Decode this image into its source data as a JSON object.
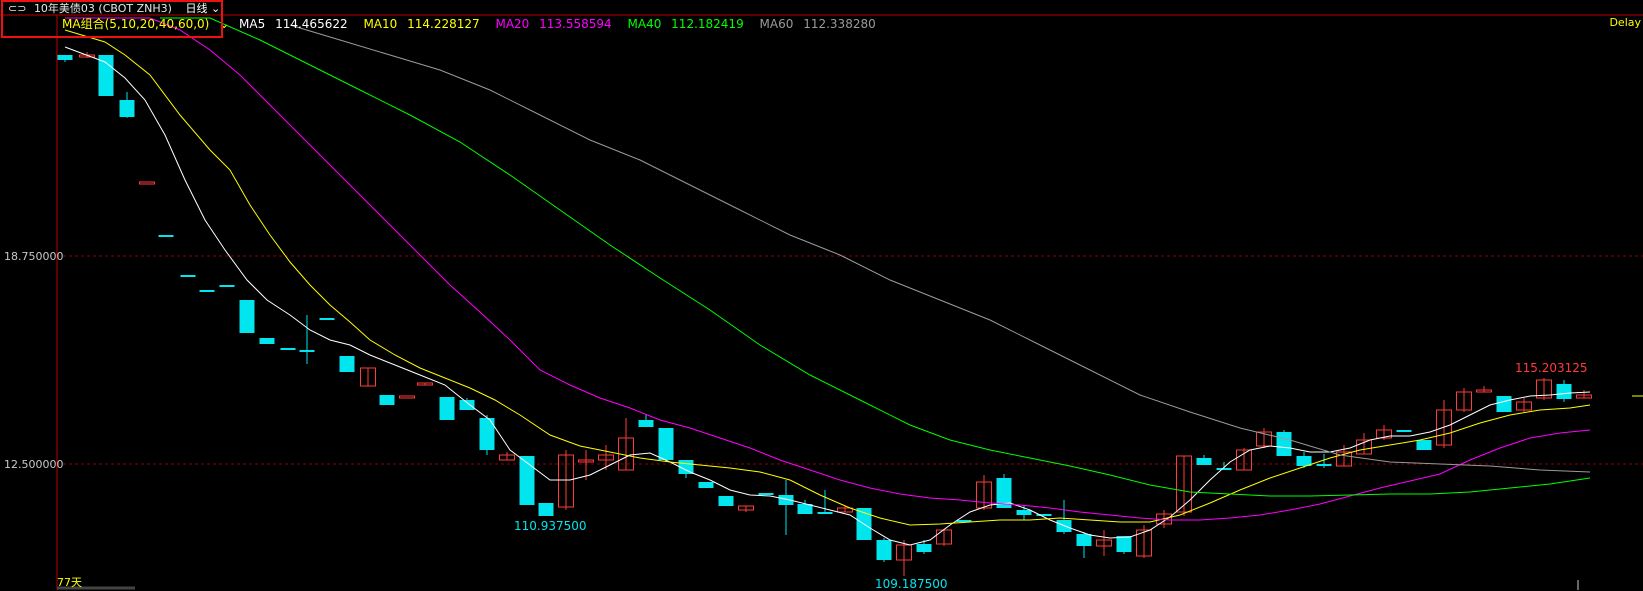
{
  "header": {
    "symbol": "10年美债03 (CBOT ZNH3)",
    "period": "日线",
    "ma_group": "MA组合(5,10,20,40,60,0)",
    "ma": [
      {
        "label": "MA5",
        "value": "114.465622",
        "color": "#ffffff"
      },
      {
        "label": "MA10",
        "value": "114.228127",
        "color": "#ffff00"
      },
      {
        "label": "MA20",
        "value": "113.558594",
        "color": "#ff00ff"
      },
      {
        "label": "MA40",
        "value": "112.182419",
        "color": "#00ff00"
      },
      {
        "label": "MA60",
        "value": "112.338280",
        "color": "#9a9a9a"
      }
    ],
    "delay": "Delay"
  },
  "axis": {
    "y_upper": "18.750000",
    "y_lower": "12.500000"
  },
  "labels": {
    "low1": "110.937500",
    "low2": "109.187500",
    "high": "115.203125",
    "days": "77天"
  },
  "colors": {
    "up": "#ff3b3b",
    "down": "#00e5ee",
    "grid": "#8b0000"
  },
  "chart_data": {
    "type": "candlestick",
    "candles_count": 77
  }
}
